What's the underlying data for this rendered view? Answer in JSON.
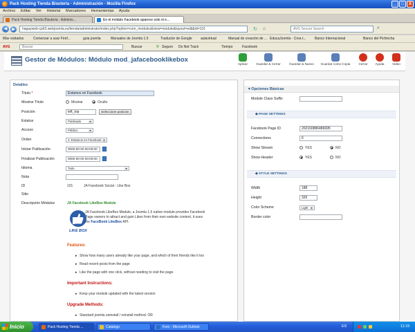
{
  "window": {
    "title": "Pack Hosting Tienda Bisuteria - Administración - Mozilla Firefox",
    "controls": [
      "_",
      "□",
      "X"
    ]
  },
  "menu": [
    "Archivo",
    "Editar",
    "Ver",
    "Historial",
    "Marcadores",
    "Herramientas",
    "Ayuda"
  ],
  "tabs": [
    {
      "label": "Pack Hosting Tienda Bisuteria - Adminis..."
    },
    {
      "label": "En el módulo Facebook aparece solo el e..."
    }
  ],
  "nav": {
    "url": "hagayweb-cp63.webjoomla.es/tienda/administrator/index.php?option=com_modules&view=module&layout=edit&id=101",
    "search_placeholder": "AVG Secure Search"
  },
  "bookmarks": [
    "Más visitados",
    "Comenzar a usar Firef...",
    "guia joomla",
    "Manuales de Joomla 1.5",
    "Traductor de Google",
    "aulavirtual",
    "Manual de creación de ...",
    "EducaJoomla - Crea t...",
    "Banco Internacional",
    "Banco del Pichincha"
  ],
  "avg_toolbar": {
    "search_placeholder": "Buscar",
    "buscar": "Buscar",
    "seguro": "Seguro",
    "do_not_track": "Do Not Track",
    "tiempo": "Tiempo",
    "facebook": "Facebook"
  },
  "header": {
    "title": "Gestor de Módulos: Módulo mod_jafacebooklikebox",
    "buttons": [
      {
        "label": "Aplicar",
        "color": "#2f9e3a"
      },
      {
        "label": "Guardar & Cerrar",
        "color": "#5a7fb8"
      },
      {
        "label": "Guardar & Nuevo",
        "color": "#5a7fb8"
      },
      {
        "label": "Guardar como Copia",
        "color": "#5a7fb8"
      },
      {
        "label": "Cerrar",
        "color": "#d2301c"
      },
      {
        "label": "Ayuda",
        "color": "#d2301c"
      },
      {
        "label": "Video",
        "color": "#d2301c"
      }
    ]
  },
  "details": {
    "legend": "Detalles",
    "titulo_label": "Título",
    "titulo_value": "Estamos en Facebook",
    "mostrar_titulo_label": "Mostrar Título",
    "mostrar_label": "Mostrar",
    "oculto_label": "Oculto",
    "posicion_label": "Posición",
    "posicion_value": "left_top",
    "seleccione_button": "Seleccione posicion",
    "estatus_label": "Estatus",
    "estatus_value": "Publicado",
    "acceso_label": "Acceso",
    "acceso_value": "Público",
    "orden_label": "Orden",
    "orden_value": "4. Estamos en Facebook",
    "iniciar_label": "Iniciar Publicación",
    "iniciar_value": "0000-00-00 00:00:00",
    "finalizar_label": "Finalizar Publicación",
    "finalizar_value": "0000-00-00 00:00:00",
    "idioma_label": "Idioma",
    "idioma_value": "Todo",
    "nota_label": "Nota",
    "nota_value": "",
    "id_label": "ID",
    "id_value": "101",
    "id_desc": "JA Facebook Social - Like Box",
    "sitio_label": "Sitio",
    "descripcion_label": "Descripción Módulos",
    "module_heading": "JA Facebook LikeBox Module",
    "desc_text_1": "JA Facebook LikeBox Module, a Joomla 1.5 native module provides Facebook",
    "desc_text_2": "Page owners to attract and gain Likes from their own website content, it uses",
    "desc_text_3_prefix": "the",
    "desc_link": "FaceBook LikeBox",
    "desc_text_3_suffix": "API.",
    "likebox_caption": "LIKE BOX",
    "features_heading": "Features:",
    "features": [
      "Show how many users already like your page, and which of their friends like it too",
      "Read recent posts from the page",
      "Like the page with one click, without needing to visit the page"
    ],
    "important_heading": "Important Instructions:",
    "important": [
      "Keep your module updated with the latest version"
    ],
    "upgrade_heading": "Upgrade Methods:",
    "upgrade": [
      "Standard joomla uninstall / reinstall method. OR"
    ]
  },
  "options": {
    "head": "Opciones Básicas",
    "module_class_suffix_label": "Module Class Suffix",
    "module_class_suffix_value": "",
    "page_settings": "PAGE SETTINGS",
    "fb_page_id_label": "Facebook Page ID",
    "fb_page_id_value": "202160886486695",
    "connections_label": "Connections",
    "connections_value": "6",
    "show_stream_label": "Show Stream",
    "show_header_label": "Show Header",
    "yes": "YES",
    "no": "NO",
    "show_stream": "NO",
    "show_header": "YES",
    "style_settings": "STYLE SETTINGS",
    "width_label": "Width",
    "width_value": "188",
    "height_label": "Height",
    "height_value": "320",
    "color_scheme_label": "Color Scheme",
    "color_scheme_value": "Light",
    "border_color_label": "Border color",
    "border_color_value": ""
  },
  "taskbar": {
    "start": "Inicio",
    "tasks": [
      "Pack Hosting Tienda ...",
      "Catalogo",
      "Foro - Microsoft Outlook"
    ],
    "lang": "ES",
    "clock": "11:15"
  }
}
